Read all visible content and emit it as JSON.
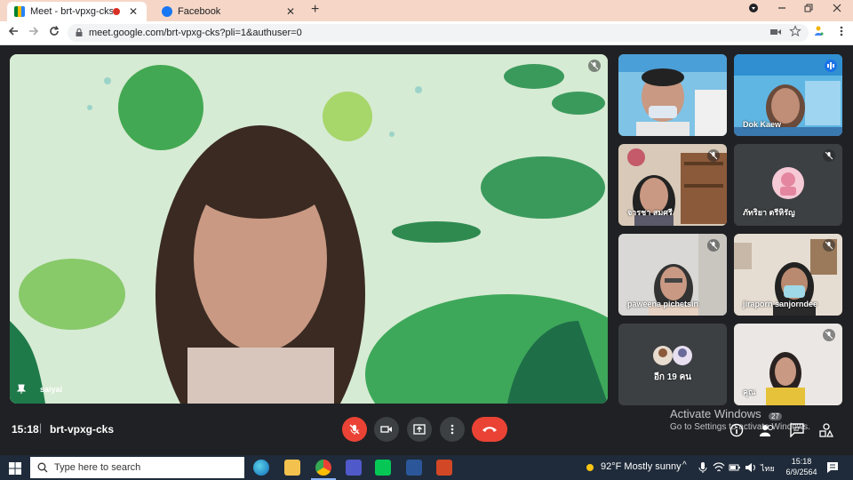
{
  "browser": {
    "tabs": [
      {
        "title": "Meet - brt-vpxg-cks",
        "icon": "google-meet-icon",
        "recording": true
      },
      {
        "title": "Facebook",
        "icon": "facebook-icon"
      }
    ],
    "new_tab_label": "+",
    "close_glyph": "✕",
    "url": "meet.google.com/brt-vpxg-cks?pli=1&authuser=0"
  },
  "meet": {
    "main_speaker": "saiyai",
    "tiles": [
      {
        "name": "",
        "muted": false
      },
      {
        "name": "Dok Kaew",
        "muted": false
      },
      {
        "name": "จารชา สมศรี",
        "muted": true
      },
      {
        "name": "ภัทริยา ตรีหิรัญ",
        "muted": true
      },
      {
        "name": "paweena pichetsin",
        "muted": true
      },
      {
        "name": "jiraporn sanjorndee",
        "muted": true
      },
      {
        "name": "อีก 19 คน",
        "muted": false
      },
      {
        "name": "คุณ",
        "muted": true
      }
    ],
    "clock": "15:18",
    "separator": "|",
    "meeting_code": "brt-vpxg-cks",
    "participant_count": "27",
    "colors": {
      "end_call": "#ea4335",
      "mic_off": "#ea4335",
      "background": "#202124"
    }
  },
  "watermark": {
    "line1": "Activate Windows",
    "line2": "Go to Settings to activate Windows."
  },
  "taskbar": {
    "search_placeholder": "Type here to search",
    "weather": "92°F  Mostly sunny",
    "tray": "^",
    "language": "ไทย",
    "time": "15:18",
    "date": "6/9/2564"
  }
}
